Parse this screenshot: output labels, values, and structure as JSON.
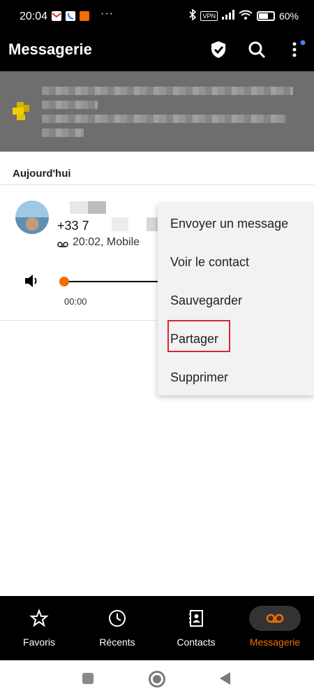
{
  "status_bar": {
    "time": "20:04",
    "notification_icons": [
      "gmail-icon",
      "phone-app-icon",
      "orange-app-icon"
    ],
    "more": "···",
    "vpn": "VPN",
    "battery": "60%"
  },
  "app_bar": {
    "title": "Messagerie",
    "icons": [
      "shield-check-icon",
      "search-icon",
      "more-vertical-icon"
    ]
  },
  "banner": {
    "text_blurred": true
  },
  "section": {
    "title": "Aujourd'hui"
  },
  "voicemail": {
    "number_prefix": "+33 7",
    "meta": "20:02, Mobile",
    "elapsed": "00:00",
    "progress": 0
  },
  "menu": {
    "items": [
      "Envoyer un message",
      "Voir le contact",
      "Sauvegarder",
      "Partager",
      "Supprimer"
    ],
    "highlighted": "Partager"
  },
  "bottom_nav": {
    "items": [
      {
        "label": "Favoris",
        "icon": "star-icon"
      },
      {
        "label": "Récents",
        "icon": "clock-icon"
      },
      {
        "label": "Contacts",
        "icon": "contacts-book-icon"
      },
      {
        "label": "Messagerie",
        "icon": "voicemail-icon"
      }
    ],
    "active": "Messagerie"
  },
  "colors": {
    "accent": "#f16e00",
    "highlight_border": "#d9262c"
  }
}
